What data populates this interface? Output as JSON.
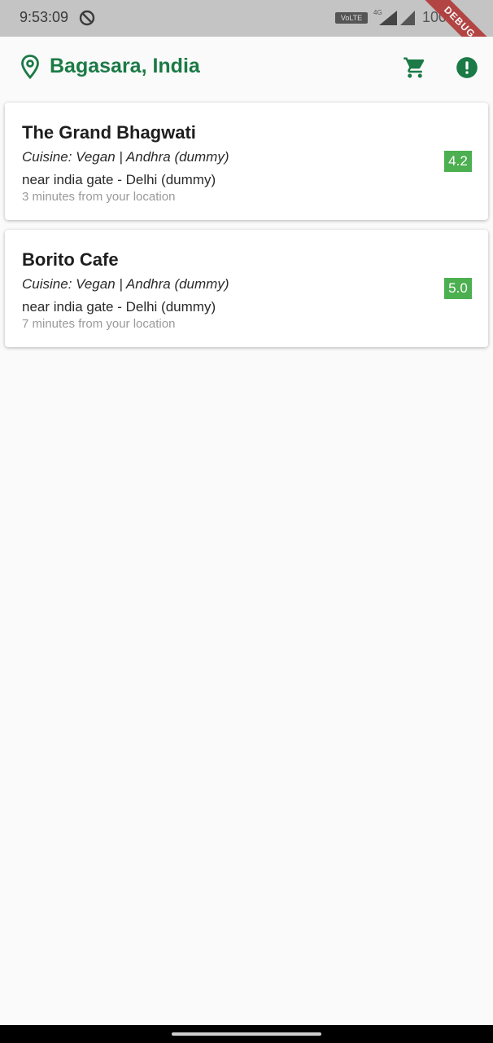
{
  "status_bar": {
    "time": "9:53:09",
    "volte": "VoLTE",
    "network": "4G",
    "battery": "100%"
  },
  "debug_banner": "DEBUG",
  "app_bar": {
    "location": "Bagasara, India",
    "icons": [
      "location-pin-icon",
      "cart-icon",
      "info-icon"
    ]
  },
  "restaurants": [
    {
      "name": "The Grand Bhagwati",
      "cuisine": "Cuisine: Vegan | Andhra (dummy)",
      "address": "near india gate - Delhi (dummy)",
      "eta": "3 minutes from your location",
      "rating": "4.2"
    },
    {
      "name": "Borito Cafe",
      "cuisine": "Cuisine: Vegan | Andhra (dummy)",
      "address": "near india gate - Delhi (dummy)",
      "eta": "7 minutes from your location",
      "rating": "5.0"
    }
  ],
  "colors": {
    "brand_green": "#1b7a45",
    "rating_green": "#4caf50",
    "background": "#fafafa",
    "status_bar": "#c4c4c4",
    "debug_banner": "#b23a3a"
  }
}
